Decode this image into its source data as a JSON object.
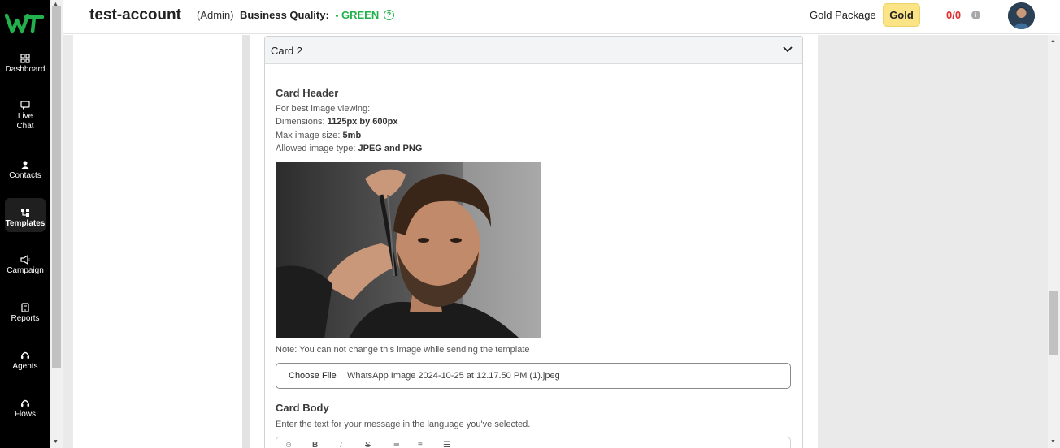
{
  "brand": {
    "logo_text": "W"
  },
  "sidebar": {
    "items": [
      {
        "label": "Dashboard",
        "icon": "dashboard-icon"
      },
      {
        "label": "Live Chat",
        "icon": "chat-icon"
      },
      {
        "label": "Contacts",
        "icon": "contacts-icon"
      },
      {
        "label": "Templates",
        "icon": "templates-icon",
        "active": true
      },
      {
        "label": "Campaign",
        "icon": "megaphone-icon"
      },
      {
        "label": "Reports",
        "icon": "reports-icon"
      },
      {
        "label": "Agents",
        "icon": "headset-icon"
      },
      {
        "label": "Flows",
        "icon": "flows-icon"
      }
    ]
  },
  "header": {
    "account_name": "test-account",
    "role": "(Admin)",
    "business_quality_label": "Business Quality:",
    "business_quality_value": "GREEN",
    "help_glyph": "?",
    "package_label": "Gold Package",
    "package_badge": "Gold",
    "usage_count": "0/0",
    "info_glyph": "i"
  },
  "card": {
    "title": "Card 2",
    "header_section": {
      "title": "Card Header",
      "guidelines_intro": "For best image viewing:",
      "dimensions_label": "Dimensions:",
      "dimensions_value": "1125px by 600px",
      "max_size_label": "Max image size:",
      "max_size_value": "5mb",
      "type_label": "Allowed image type:",
      "type_value": "JPEG and PNG",
      "note": "Note: You can not change this image while sending the template",
      "file_button": "Choose File",
      "file_name": "WhatsApp Image 2024-10-25 at 12.17.50 PM (1).jpeg"
    },
    "body_section": {
      "title": "Card Body",
      "hint": "Enter the text for your message in the language you've selected."
    }
  },
  "colors": {
    "sidebar_bg": "#000000",
    "brand_green": "#22b14c",
    "gold_badge": "#fbe486",
    "usage_red": "#e03131"
  }
}
